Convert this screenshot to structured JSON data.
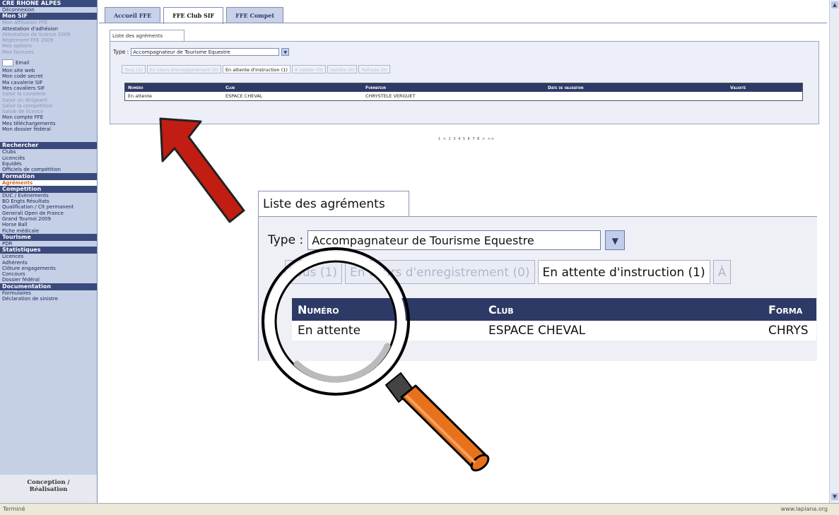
{
  "sidebar": {
    "header_region": "CRE RHONE ALPES",
    "deconnexion": "Déconnexion",
    "mon_sif_header": "Mon SIF",
    "dim_items": [
      "Mon affiliation FFE",
      "Attestation d'adhésion",
      "Attestation de licence 2009",
      "Règlement FFE 2009",
      "Mes options",
      "Mes factures"
    ],
    "email_label": "Email",
    "items_a": [
      "Mon site web",
      "Mon code secret",
      "Ma cavalerie SIF",
      "Mes cavaliers SIF"
    ],
    "dim_items_b": [
      "Saisir la cavalerie",
      "Saisir un dirigeant",
      "Saisir la compétition",
      "Saisie de licence"
    ],
    "items_b": [
      "Mon compte FFE",
      "Mes téléchargements",
      "Mon dossier fédéral"
    ],
    "recherche_header": "Rechercher",
    "recherche_items": [
      "Clubs",
      "Licenciés",
      "Equidés",
      "Officiels de compétition"
    ],
    "formation_header": "Formation",
    "formation_active": "Agréments",
    "competition_header": "Compétition",
    "competition_items": [
      "DUC / Evénements",
      "BO Engts Résultats",
      "Qualification / Clt permanent",
      "Generali Open de France",
      "Grand Tournoi 2009",
      "Horse Ball",
      "Fiche médicale"
    ],
    "tourisme_header": "Tourisme",
    "tourisme_items": [
      "PDR"
    ],
    "stats_header": "Statistiques",
    "stats_items": [
      "Licences",
      "Adhérents",
      "Clôture engagements",
      "Concours",
      "Dossier fédéral"
    ],
    "doc_header": "Documentation",
    "doc_items": [
      "Formulaires",
      "Déclaration de sinistre"
    ],
    "footer_line1": "Conception /",
    "footer_line2": "Réalisation"
  },
  "top_tabs": [
    "Accueil FFE",
    "FFE Club SIF",
    "FFE Compet"
  ],
  "panel": {
    "tab_label": "Liste des agréments",
    "type_label": "Type :",
    "type_value": "Accompagnateur de Tourisme Equestre",
    "subtabs": [
      "Tous (1)",
      "En cours d'enregistrement (0)",
      "En attente d'instruction (1)",
      "A valider (0)",
      "Validés (0)",
      "Refusés (0)"
    ],
    "table_headers": [
      "Numéro",
      "Club",
      "Formateur",
      "Date de validation",
      "Validité"
    ],
    "row": [
      "En attente",
      "ESPACE CHEVAL",
      "CHRYSTELE VERGUET",
      "",
      ""
    ],
    "pager": "1 < 2 3 4 5 6 7 8 > >>"
  },
  "zoom": {
    "tab_label": "Liste des agréments",
    "type_label": "Type :",
    "type_value": "Accompagnateur de Tourisme Equestre",
    "subtabs": [
      "Tous (1)",
      "En cours d'enregistrement (0)",
      "En attente d'instruction (1)",
      "À"
    ],
    "table_headers": [
      "Numéro",
      "Club",
      "Forma"
    ],
    "row": [
      "En attente",
      "ESPACE CHEVAL",
      "CHRYS"
    ]
  },
  "statusbar": {
    "left": "Terminé",
    "right": "www.lapiana.org"
  },
  "colors": {
    "arrow": "#c11d12",
    "magnifier_handle": "#e8721c",
    "sidebar_header": "#3a4a7c",
    "table_header": "#2e3a66"
  }
}
